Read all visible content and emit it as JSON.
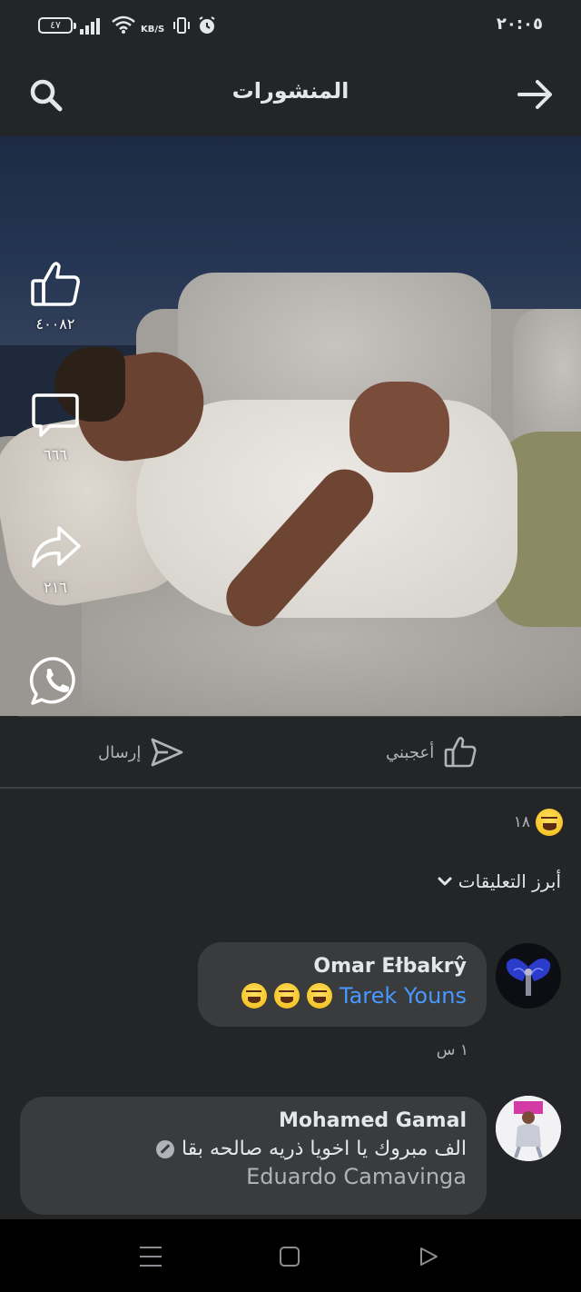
{
  "status_bar": {
    "battery": "٤٧",
    "net_speed": "KB/S",
    "time": "٢٠:٠٥"
  },
  "header": {
    "title": "المنشورات"
  },
  "video_actions": {
    "likes": "٤٠٠٨٢",
    "comments": "٦٦٦",
    "shares": "٢١٦"
  },
  "actions": {
    "like_label": "أعجبني",
    "send_label": "إرسال"
  },
  "reactions": {
    "count": "١٨"
  },
  "comments_section": {
    "sort_label": "أبرز التعليقات"
  },
  "comments": [
    {
      "author": "Omar Ełbakrŷ",
      "tag": "Tarek Youns",
      "time": "١ س"
    },
    {
      "author": "Mohamed Gamal",
      "text": "الف مبروك يا اخويا ذريه صالحه بقا",
      "tag": "Eduardo Camavinga"
    }
  ],
  "colors": {
    "background": "#242526",
    "bubble": "#3a3b3c",
    "link": "#4599ff",
    "text": "#e4e6eb",
    "muted": "#b0b3b8"
  },
  "icons": [
    "search-icon",
    "arrow-right-icon",
    "thumbs-up-icon",
    "comment-icon",
    "share-icon",
    "whatsapp-icon",
    "send-icon",
    "haha-emoji-icon",
    "chevron-down-icon",
    "blocked-icon"
  ]
}
